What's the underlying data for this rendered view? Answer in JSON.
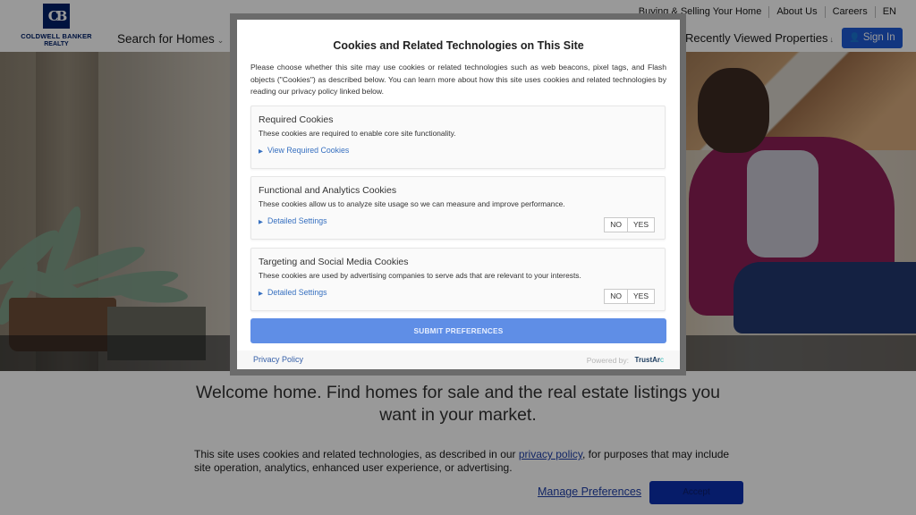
{
  "header": {
    "logo": {
      "mark": "CB",
      "name": "COLDWELL BANKER",
      "sub": "REALTY"
    },
    "search_nav": "Search for Homes",
    "utility_links": [
      "Buying & Selling Your Home",
      "About Us",
      "Careers",
      "EN"
    ],
    "recently_viewed": "Recently Viewed Properties",
    "sign_in": "Sign In"
  },
  "hero": {
    "welcome": "Welcome home. Find homes for sale and the real estate listings you want in your market."
  },
  "modal": {
    "title": "Cookies and Related Technologies on This Site",
    "intro": "Please choose whether this site may use cookies or related technologies such as web beacons, pixel tags, and Flash objects (\"Cookies\") as described below. You can learn more about how this site uses cookies and related technologies by reading our privacy policy linked below.",
    "sections": [
      {
        "title": "Required Cookies",
        "description": "These cookies are required to enable core site functionality.",
        "link": "View Required Cookies"
      },
      {
        "title": "Functional and Analytics Cookies",
        "description": "These cookies allow us to analyze site usage so we can measure and improve performance.",
        "link": "Detailed Settings",
        "no": "NO",
        "yes": "YES"
      },
      {
        "title": "Targeting and Social Media Cookies",
        "description": "These cookies are used by advertising companies to serve ads that are relevant to your interests.",
        "link": "Detailed Settings",
        "no": "NO",
        "yes": "YES"
      }
    ],
    "submit": "SUBMIT PREFERENCES",
    "privacy_policy": "Privacy Policy",
    "powered_by": "Powered by:",
    "vendor": "TrustAr",
    "vendor_suffix": "c"
  },
  "banner": {
    "text_before": "This site uses cookies and related technologies, as described in our ",
    "link": "privacy policy",
    "text_after": ", for purposes that may include site operation, analytics, enhanced user experience, or advertising.",
    "manage": "Manage Preferences",
    "accept": "Accept"
  },
  "colors": {
    "brand_navy": "#012169",
    "sign_in_blue": "#1f5bd6",
    "submit_blue": "#5f8ee6",
    "link_blue": "#3770c0",
    "accept_blue": "#0a2fb0"
  }
}
